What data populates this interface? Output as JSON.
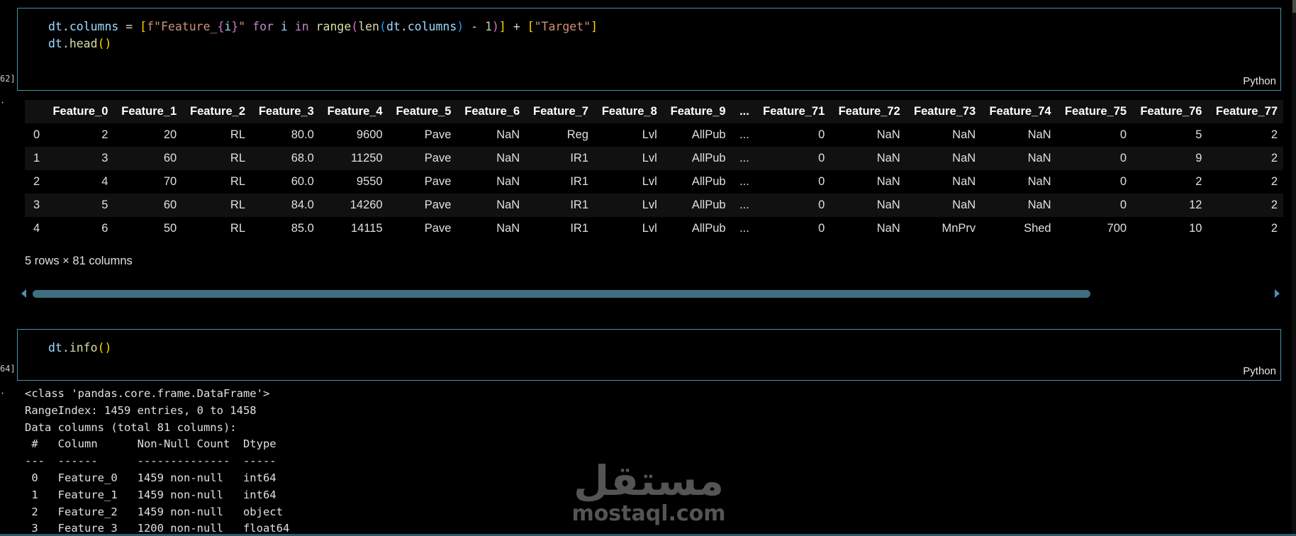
{
  "cells": [
    {
      "exec_label": "62]",
      "language": "Python",
      "code_lines": [
        "dt.columns = [f\"Feature_{i}\" for i in range(len(dt.columns) - 1)] + [\"Target\"]",
        "dt.head()"
      ]
    },
    {
      "exec_label": "64]",
      "language": "Python",
      "code_lines": [
        "dt.info()"
      ]
    }
  ],
  "output_marker": "·",
  "dataframe": {
    "columns": [
      "",
      "Feature_0",
      "Feature_1",
      "Feature_2",
      "Feature_3",
      "Feature_4",
      "Feature_5",
      "Feature_6",
      "Feature_7",
      "Feature_8",
      "Feature_9",
      "...",
      "Feature_71",
      "Feature_72",
      "Feature_73",
      "Feature_74",
      "Feature_75",
      "Feature_76",
      "Feature_77"
    ],
    "rows": [
      [
        "0",
        "2",
        "20",
        "RL",
        "80.0",
        "9600",
        "Pave",
        "NaN",
        "Reg",
        "Lvl",
        "AllPub",
        "...",
        "0",
        "NaN",
        "NaN",
        "NaN",
        "0",
        "5",
        "2"
      ],
      [
        "1",
        "3",
        "60",
        "RL",
        "68.0",
        "11250",
        "Pave",
        "NaN",
        "IR1",
        "Lvl",
        "AllPub",
        "...",
        "0",
        "NaN",
        "NaN",
        "NaN",
        "0",
        "9",
        "2"
      ],
      [
        "2",
        "4",
        "70",
        "RL",
        "60.0",
        "9550",
        "Pave",
        "NaN",
        "IR1",
        "Lvl",
        "AllPub",
        "...",
        "0",
        "NaN",
        "NaN",
        "NaN",
        "0",
        "2",
        "2"
      ],
      [
        "3",
        "5",
        "60",
        "RL",
        "84.0",
        "14260",
        "Pave",
        "NaN",
        "IR1",
        "Lvl",
        "AllPub",
        "...",
        "0",
        "NaN",
        "NaN",
        "NaN",
        "0",
        "12",
        "2"
      ],
      [
        "4",
        "6",
        "50",
        "RL",
        "85.0",
        "14115",
        "Pave",
        "NaN",
        "IR1",
        "Lvl",
        "AllPub",
        "...",
        "0",
        "NaN",
        "MnPrv",
        "Shed",
        "700",
        "10",
        "2"
      ]
    ],
    "shape_text": "5 rows × 81 columns"
  },
  "info_output": {
    "lines": [
      "<class 'pandas.core.frame.DataFrame'>",
      "RangeIndex: 1459 entries, 0 to 1458",
      "Data columns (total 81 columns):",
      " #   Column      Non-Null Count  Dtype  ",
      "---  ------      --------------  -----  ",
      " 0   Feature_0   1459 non-null   int64  ",
      " 1   Feature_1   1459 non-null   int64  ",
      " 2   Feature_2   1459 non-null   object ",
      " 3   Feature_3   1200 non-null   float64"
    ]
  },
  "watermark": {
    "arabic": "مستقل",
    "latin": "mostaql.com"
  },
  "colors": {
    "cell_border": "#4a8fae",
    "scroll_thumb": "#3e6f80",
    "background": "#000000"
  }
}
